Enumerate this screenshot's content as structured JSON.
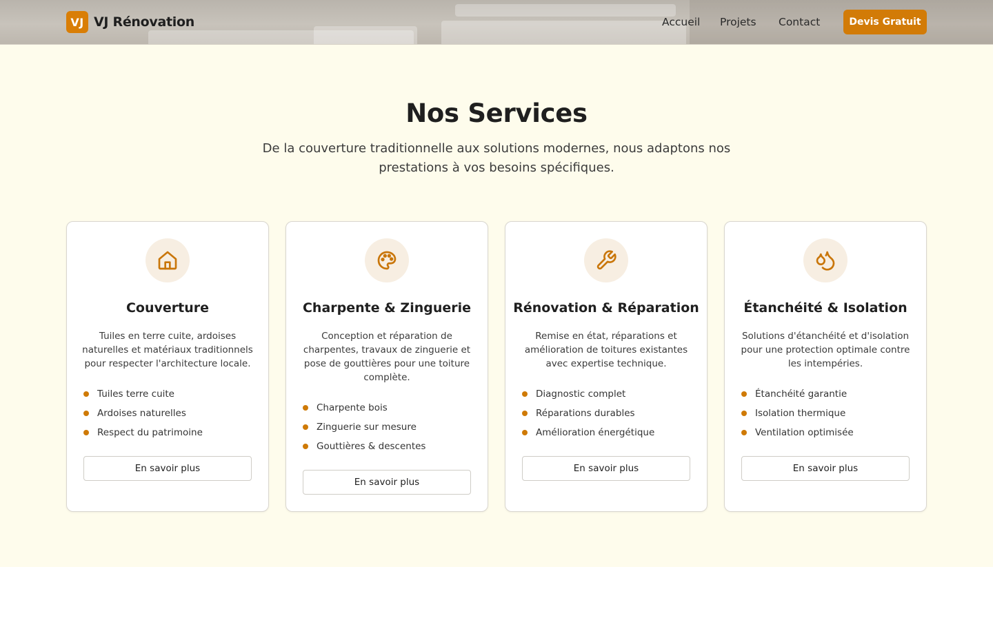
{
  "header": {
    "logo_text": "VJ",
    "brand": "VJ Rénovation",
    "nav": [
      "Accueil",
      "Projets",
      "Contact"
    ],
    "cta": "Devis Gratuit"
  },
  "services": {
    "title": "Nos Services",
    "subtitle": "De la couverture traditionnelle aux solutions modernes, nous adaptons nos prestations à vos besoins spécifiques.",
    "cards": [
      {
        "icon": "house-icon",
        "title": "Couverture",
        "description": "Tuiles en terre cuite, ardoises naturelles et matériaux traditionnels pour respecter l'architecture locale.",
        "features": [
          "Tuiles terre cuite",
          "Ardoises naturelles",
          "Respect du patrimoine"
        ],
        "button": "En savoir plus"
      },
      {
        "icon": "palette-icon",
        "title": "Charpente & Zinguerie",
        "description": "Conception et réparation de charpentes, travaux de zinguerie et pose de gouttières pour une toiture complète.",
        "features": [
          "Charpente bois",
          "Zinguerie sur mesure",
          "Gouttières & descentes"
        ],
        "button": "En savoir plus"
      },
      {
        "icon": "wrench-icon",
        "title": "Rénovation & Réparation",
        "description": "Remise en état, réparations et amélioration de toitures existantes avec expertise technique.",
        "features": [
          "Diagnostic complet",
          "Réparations durables",
          "Amélioration énergétique"
        ],
        "button": "En savoir plus"
      },
      {
        "icon": "droplets-icon",
        "title": "Étanchéité & Isolation",
        "description": "Solutions d'étanchéité et d'isolation pour une protection optimale contre les intempéries.",
        "features": [
          "Étanchéité garantie",
          "Isolation thermique",
          "Ventilation optimisée"
        ],
        "button": "En savoir plus"
      }
    ]
  },
  "colors": {
    "accent": "#d27b07",
    "section_bg": "#fefcec",
    "icon_bg": "#f7eee2"
  }
}
